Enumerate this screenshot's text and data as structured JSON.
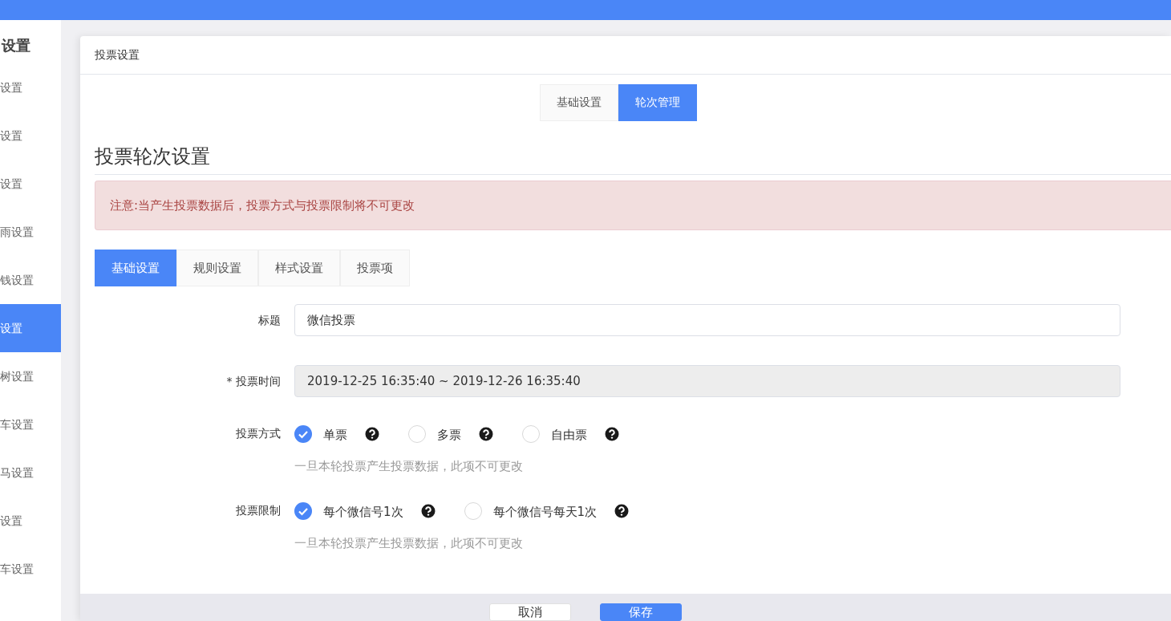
{
  "sidebar": {
    "title": "设置",
    "items": [
      {
        "label": "设置",
        "selected": false
      },
      {
        "label": "设置",
        "selected": false
      },
      {
        "label": "设置",
        "selected": false
      },
      {
        "label": "雨设置",
        "selected": false
      },
      {
        "label": "钱设置",
        "selected": false
      },
      {
        "label": "设置",
        "selected": true
      },
      {
        "label": "树设置",
        "selected": false
      },
      {
        "label": "车设置",
        "selected": false
      },
      {
        "label": "马设置",
        "selected": false
      },
      {
        "label": "设置",
        "selected": false
      },
      {
        "label": "车设置",
        "selected": false
      }
    ]
  },
  "panel": {
    "title": "投票设置",
    "top_tabs": [
      {
        "label": "基础设置",
        "selected": false
      },
      {
        "label": "轮次管理",
        "selected": true
      }
    ],
    "heading": "投票轮次设置",
    "alert": "注意:当产生投票数据后，投票方式与投票限制将不可更改",
    "tabs": [
      {
        "label": "基础设置",
        "selected": true
      },
      {
        "label": "规则设置",
        "selected": false
      },
      {
        "label": "样式设置",
        "selected": false
      },
      {
        "label": "投票项",
        "selected": false
      }
    ],
    "form": [
      {
        "kind": "text",
        "label": "标题",
        "value": "微信投票",
        "disabled": false
      },
      {
        "kind": "text",
        "label": "* 投票时间",
        "value": "2019-12-25 16:35:40 ~ 2019-12-26 16:35:40",
        "disabled": true
      },
      {
        "kind": "radio",
        "label": "投票方式",
        "options": [
          {
            "label": "单票",
            "selected": true
          },
          {
            "label": "多票",
            "selected": false
          },
          {
            "label": "自由票",
            "selected": false
          }
        ],
        "hint": "一旦本轮投票产生投票数据，此项不可更改"
      },
      {
        "kind": "radio",
        "label": "投票限制",
        "options": [
          {
            "label": "每个微信号1次",
            "selected": true
          },
          {
            "label": "每个微信号每天1次",
            "selected": false
          }
        ],
        "hint": "一旦本轮投票产生投票数据，此项不可更改"
      }
    ],
    "buttons": [
      {
        "label": "取消",
        "kind": "default"
      },
      {
        "label": "保存",
        "kind": "primary"
      }
    ]
  }
}
